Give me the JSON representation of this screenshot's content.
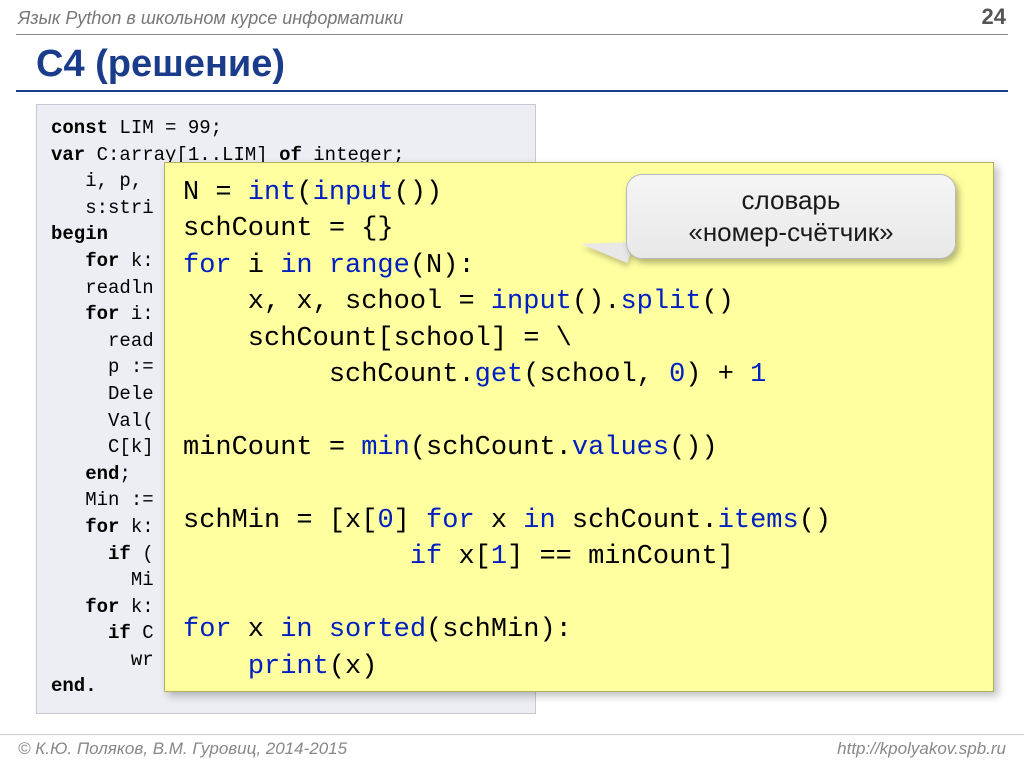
{
  "header": {
    "subject": "Язык Python в школьном курсе информатики",
    "page": "24"
  },
  "title": "C4 (решение)",
  "pascal": {
    "l1a": "const",
    "l1b": " LIM = 99;",
    "l2a": "var",
    "l2b": " C:array[1..LIM] ",
    "l2c": "of",
    "l2d": " integer;",
    "l3": "   i, p,",
    "l4": "   s:stri",
    "l5": "begin",
    "l6a": "   ",
    "l6b": "for",
    "l6c": " k:",
    "l7": "   readln",
    "l8a": "   ",
    "l8b": "for",
    "l8c": " i:",
    "l9": "     read",
    "l10": "     p :=",
    "l11": "     Dele",
    "l12": "     Val(",
    "l13": "     C[k]",
    "l14a": "   ",
    "l14b": "end",
    "l14c": ";",
    "l15": "   Min :=",
    "l16a": "   ",
    "l16b": "for",
    "l16c": " k:",
    "l17a": "     ",
    "l17b": "if",
    "l17c": " (",
    "l18": "       Mi",
    "l19a": "   ",
    "l19b": "for",
    "l19c": " k:",
    "l20a": "     ",
    "l20b": "if",
    "l20c": " C",
    "l21": "       wr",
    "l22": "end."
  },
  "python": {
    "t1a": "N = ",
    "t1b": "int",
    "t1c": "(",
    "t1d": "input",
    "t1e": "())",
    "t2": "schCount = {}",
    "t3a": "for",
    "t3b": " i ",
    "t3c": "in",
    "t3d": " ",
    "t3e": "range",
    "t3f": "(N):",
    "t4a": "    x, x, school = ",
    "t4b": "input",
    "t4c": "().",
    "t4d": "split",
    "t4e": "()",
    "t5": "    schCount[school] = \\",
    "t6a": "         schCount.",
    "t6b": "get",
    "t6c": "(school, ",
    "t6d": "0",
    "t6e": ") + ",
    "t6f": "1",
    "t7a": "minCount = ",
    "t7b": "min",
    "t7c": "(schCount.",
    "t7d": "values",
    "t7e": "())",
    "t8a": "schMin = [x[",
    "t8b": "0",
    "t8c": "] ",
    "t8d": "for",
    "t8e": " x ",
    "t8f": "in",
    "t8g": " schCount.",
    "t8h": "items",
    "t8i": "()",
    "t9a": "              ",
    "t9b": "if",
    "t9c": " x[",
    "t9d": "1",
    "t9e": "] == minCount]",
    "t10a": "for",
    "t10b": " x ",
    "t10c": "in",
    "t10d": " ",
    "t10e": "sorted",
    "t10f": "(schMin):",
    "t11a": "    ",
    "t11b": "print",
    "t11c": "(x)"
  },
  "bubble": {
    "line1": "словарь",
    "line2": "«номер-счётчик»"
  },
  "footer": {
    "left": "© К.Ю. Поляков, В.М. Гуровиц, 2014-2015",
    "right": "http://kpolyakov.spb.ru"
  }
}
